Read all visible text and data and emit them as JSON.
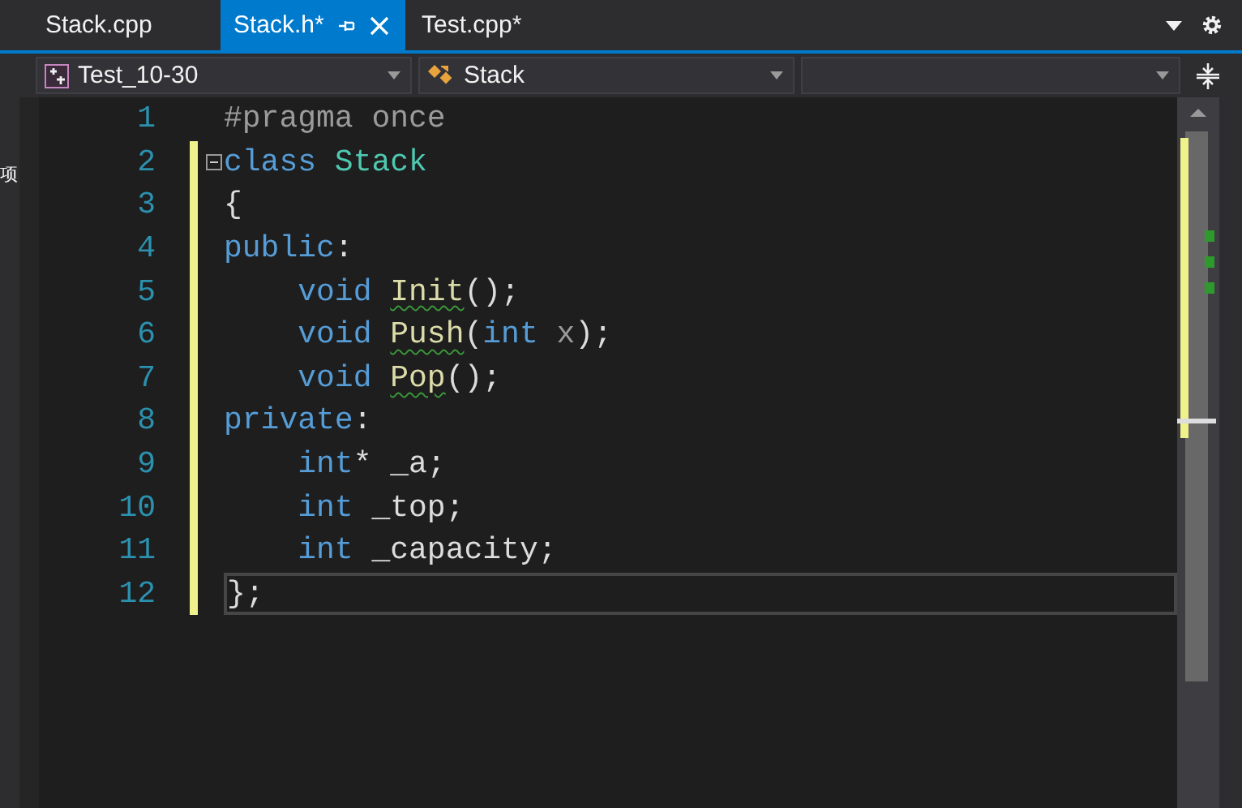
{
  "tabs": [
    {
      "label": "Stack.cpp",
      "selected": false,
      "pinnable": false
    },
    {
      "label": "Stack.h*",
      "selected": true,
      "pinnable": true
    },
    {
      "label": "Test.cpp*",
      "selected": false,
      "pinnable": false
    }
  ],
  "side_panel": {
    "label": "项"
  },
  "navigation": {
    "project": "Test_10-30",
    "scope": "Stack"
  },
  "code_lines": [
    {
      "number": "1",
      "modified": false,
      "current": false,
      "foldable": false,
      "tokens": [
        {
          "text": "#pragma once",
          "kind": "preproc"
        }
      ]
    },
    {
      "number": "2",
      "modified": true,
      "current": false,
      "foldable": true,
      "tokens": [
        {
          "text": "class ",
          "kind": "keyword"
        },
        {
          "text": "Stack",
          "kind": "type"
        }
      ]
    },
    {
      "number": "3",
      "modified": true,
      "current": false,
      "foldable": false,
      "tokens": [
        {
          "text": "{",
          "kind": "plain"
        }
      ]
    },
    {
      "number": "4",
      "modified": true,
      "current": false,
      "foldable": false,
      "tokens": [
        {
          "text": "public",
          "kind": "keyword"
        },
        {
          "text": ":",
          "kind": "plain"
        }
      ]
    },
    {
      "number": "5",
      "modified": true,
      "current": false,
      "foldable": false,
      "tokens": [
        {
          "text": "    void ",
          "kind": "keyword"
        },
        {
          "text": "Init",
          "kind": "function",
          "squiggle": true
        },
        {
          "text": "();",
          "kind": "plain"
        }
      ]
    },
    {
      "number": "6",
      "modified": true,
      "current": false,
      "foldable": false,
      "tokens": [
        {
          "text": "    void ",
          "kind": "keyword"
        },
        {
          "text": "Push",
          "kind": "function",
          "squiggle": true
        },
        {
          "text": "(",
          "kind": "plain"
        },
        {
          "text": "int",
          "kind": "keyword"
        },
        {
          "text": " x",
          "kind": "param"
        },
        {
          "text": ");",
          "kind": "plain"
        }
      ]
    },
    {
      "number": "7",
      "modified": true,
      "current": false,
      "foldable": false,
      "tokens": [
        {
          "text": "    void ",
          "kind": "keyword"
        },
        {
          "text": "Pop",
          "kind": "function",
          "squiggle": true
        },
        {
          "text": "();",
          "kind": "plain"
        }
      ]
    },
    {
      "number": "8",
      "modified": true,
      "current": false,
      "foldable": false,
      "tokens": [
        {
          "text": "private",
          "kind": "keyword"
        },
        {
          "text": ":",
          "kind": "plain"
        }
      ]
    },
    {
      "number": "9",
      "modified": true,
      "current": false,
      "foldable": false,
      "tokens": [
        {
          "text": "    int",
          "kind": "keyword"
        },
        {
          "text": "* _a;",
          "kind": "plain"
        }
      ]
    },
    {
      "number": "10",
      "modified": true,
      "current": false,
      "foldable": false,
      "tokens": [
        {
          "text": "    int",
          "kind": "keyword"
        },
        {
          "text": " _top;",
          "kind": "plain"
        }
      ]
    },
    {
      "number": "11",
      "modified": true,
      "current": false,
      "foldable": false,
      "tokens": [
        {
          "text": "    int",
          "kind": "keyword"
        },
        {
          "text": " _capacity;",
          "kind": "plain"
        }
      ]
    },
    {
      "number": "12",
      "modified": true,
      "current": true,
      "foldable": false,
      "tokens": [
        {
          "text": "};",
          "kind": "plain"
        }
      ]
    }
  ]
}
